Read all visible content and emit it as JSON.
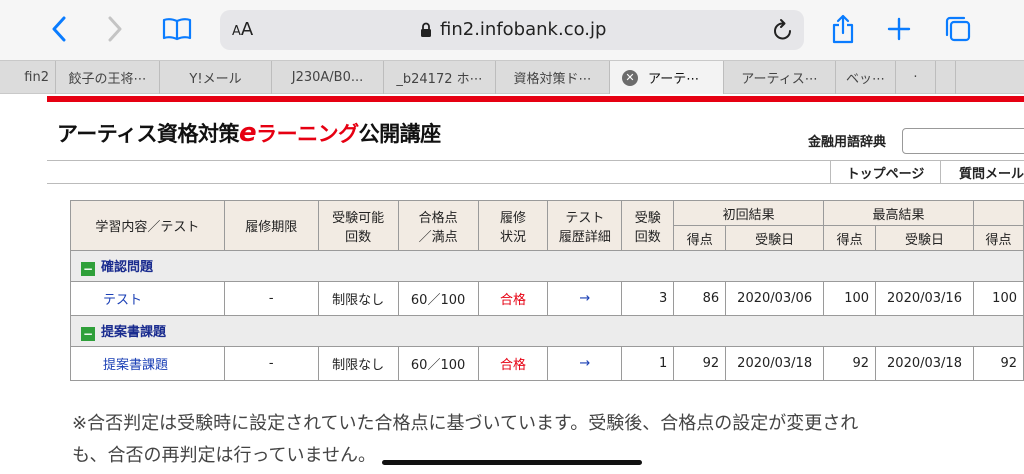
{
  "browser": {
    "aa_small": "A",
    "aa_big": "A",
    "url": "fin2.infobank.co.jp",
    "tabs": [
      {
        "label": "fin2"
      },
      {
        "label": "餃子の王将⋯"
      },
      {
        "label": "Y!メール"
      },
      {
        "label": "J230A/B0..."
      },
      {
        "label": "_b24172 ホ⋯"
      },
      {
        "label": "資格対策ド⋯"
      },
      {
        "label": "アーテ⋯",
        "active": true
      },
      {
        "label": "アーティス⋯"
      },
      {
        "label": "ベッ⋯"
      },
      {
        "label": "·"
      }
    ]
  },
  "page": {
    "title_pre": "アーティス資格対策",
    "title_e": "e",
    "title_red": "ラーニング",
    "title_post": "公開講座",
    "dict_label": "金融用語辞典",
    "nav": {
      "top_page": "トップページ",
      "faq": "質問メール"
    }
  },
  "table": {
    "headers": {
      "subject": "学習内容／テスト",
      "period": "履修期限",
      "limit_1": "受験可能",
      "limit_2": "回数",
      "pass_1": "合格点",
      "pass_2": "／満点",
      "status_1": "履修",
      "status_2": "状況",
      "hist_1": "テスト",
      "hist_2": "履歴詳細",
      "count_1": "受験",
      "count_2": "回数",
      "first": "初回結果",
      "best": "最高結果",
      "score": "得点",
      "date": "受験日"
    },
    "categories": [
      {
        "name": "確認問題",
        "row": {
          "name": "テスト",
          "period": "-",
          "limit": "制限なし",
          "pass": "60／100",
          "status": "合格",
          "detail": "→",
          "count": "3",
          "first_score": "86",
          "first_date": "2020/03/06",
          "best_score": "100",
          "best_date": "2020/03/16",
          "last_score": "100"
        }
      },
      {
        "name": "提案書課題",
        "row": {
          "name": "提案書課題",
          "period": "-",
          "limit": "制限なし",
          "pass": "60／100",
          "status": "合格",
          "detail": "→",
          "count": "1",
          "first_score": "92",
          "first_date": "2020/03/18",
          "best_score": "92",
          "best_date": "2020/03/18",
          "last_score": "92"
        }
      }
    ]
  },
  "note": {
    "line1": "※合否判定は受験時に設定されていた合格点に基づいています。受験後、合格点の設定が変更され",
    "line2": "も、合否の再判定は行っていません。"
  },
  "colors": {
    "accent": "#e60012",
    "link": "#1a3fb5",
    "header_bg": "#f2ebe3"
  }
}
